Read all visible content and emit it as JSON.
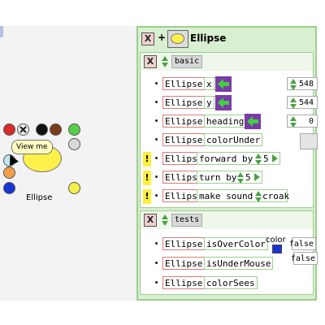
{
  "world": {
    "balloon_text": "View me",
    "object_name": "Ellipse",
    "halo_colors": [
      "#d82c2c",
      "#ececec",
      "#111111",
      "#7a3d1a",
      "#57cf48",
      "#d8d8d8",
      "#f2a04c",
      "#1a35d4",
      "#f6ef4a",
      "#bfe8f2"
    ]
  },
  "viewer": {
    "close_label": "X",
    "plus_label": "+",
    "title": "Ellipse",
    "basic": {
      "close_label": "X",
      "category": "basic",
      "rows": {
        "x": {
          "object": "Ellipse's",
          "name": "x",
          "value": "548"
        },
        "y": {
          "object": "Ellipse's",
          "name": "y",
          "value": "544"
        },
        "heading": {
          "object": "Ellipse's",
          "name": "heading",
          "value": "0"
        },
        "colorUnder": {
          "object": "Ellipse's",
          "name": "colorUnder"
        },
        "forward": {
          "bang": "!",
          "object": "Ellipse",
          "command": "forward by",
          "arg": "5"
        },
        "turn": {
          "bang": "!",
          "object": "Ellipse",
          "command": "turn by",
          "arg": "5"
        },
        "sound": {
          "bang": "!",
          "object": "Ellipse",
          "command": "make sound",
          "arg": "croak"
        }
      }
    },
    "tests": {
      "close_label": "X",
      "category": "tests",
      "rows": {
        "isOverColor": {
          "object": "Ellipse's",
          "name": "isOverColor",
          "param_label": "color",
          "swatch_color": "#1634d8",
          "value": "false"
        },
        "isUnderMouse": {
          "object": "Ellipse's",
          "name": "isUnderMouse",
          "value": "false"
        },
        "colorSees": {
          "object": "Ellipse's",
          "name": "colorSees"
        }
      }
    }
  }
}
